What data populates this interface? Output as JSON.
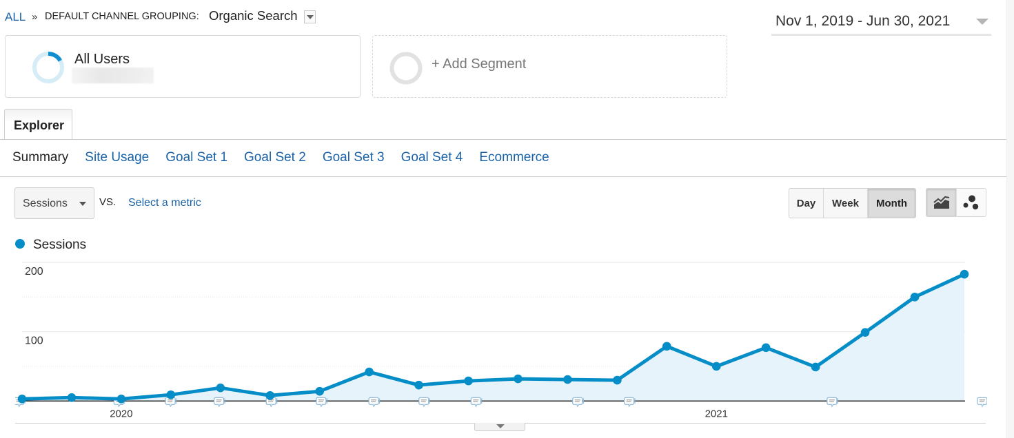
{
  "breadcrumb": {
    "root": "ALL",
    "separator": "»",
    "dimension_label": "DEFAULT CHANNEL GROUPING:",
    "dimension_value": "Organic Search"
  },
  "date_range": {
    "label": "Nov 1, 2019 - Jun 30, 2021"
  },
  "segments": {
    "active": {
      "name": "All Users"
    },
    "add_label": "+ Add Segment"
  },
  "report_tabs": [
    {
      "label": "Explorer",
      "active": true
    }
  ],
  "sub_tabs": [
    {
      "label": "Summary",
      "active": true
    },
    {
      "label": "Site Usage",
      "active": false
    },
    {
      "label": "Goal Set 1",
      "active": false
    },
    {
      "label": "Goal Set 2",
      "active": false
    },
    {
      "label": "Goal Set 3",
      "active": false
    },
    {
      "label": "Goal Set 4",
      "active": false
    },
    {
      "label": "Ecommerce",
      "active": false
    }
  ],
  "metric_selector": {
    "primary": "Sessions",
    "vs_label": "VS.",
    "secondary_placeholder": "Select a metric"
  },
  "granularity": {
    "options": [
      "Day",
      "Week",
      "Month"
    ],
    "selected": "Month"
  },
  "chart_types": [
    {
      "icon": "line-chart-icon",
      "selected": true
    },
    {
      "icon": "motion-chart-icon",
      "selected": false
    }
  ],
  "colors": {
    "series": "#058dc7",
    "area_fill": "#e6f3fa",
    "link": "#1a62a8",
    "segment_ring": "#d6edf7",
    "segment_arc": "#0f8fd0"
  },
  "chart_data": {
    "type": "area",
    "title": "",
    "xlabel": "",
    "ylabel": "",
    "categories": [
      "Nov 2019",
      "Dec 2019",
      "Jan 2020",
      "Feb 2020",
      "Mar 2020",
      "Apr 2020",
      "May 2020",
      "Jun 2020",
      "Jul 2020",
      "Aug 2020",
      "Sep 2020",
      "Oct 2020",
      "Nov 2020",
      "Dec 2020",
      "Jan 2021",
      "Feb 2021",
      "Mar 2021",
      "Apr 2021",
      "May 2021",
      "Jun 2021"
    ],
    "series": [
      {
        "name": "Sessions",
        "values": [
          3,
          5,
          3,
          9,
          19,
          8,
          14,
          42,
          23,
          29,
          32,
          31,
          30,
          79,
          50,
          77,
          49,
          99,
          150,
          183
        ]
      }
    ],
    "ylim": [
      0,
      200
    ],
    "y_ticks": [
      {
        "value": 100,
        "label": "100"
      },
      {
        "value": 200,
        "label": "200"
      }
    ],
    "gridlines_major": [
      100,
      200
    ],
    "gridlines_minor": [
      50,
      150
    ],
    "x_ticks": [
      {
        "index": 2,
        "label": "2020"
      },
      {
        "index": 14,
        "label": "2021"
      }
    ],
    "annotation_month_positions": [
      -0.06,
      1.95,
      2.99,
      3.97,
      5.02,
      6.03,
      7.09,
      8.1,
      9.15,
      11.2,
      12.24,
      16.33,
      19.36
    ],
    "legend": "top-left",
    "grid": true
  }
}
